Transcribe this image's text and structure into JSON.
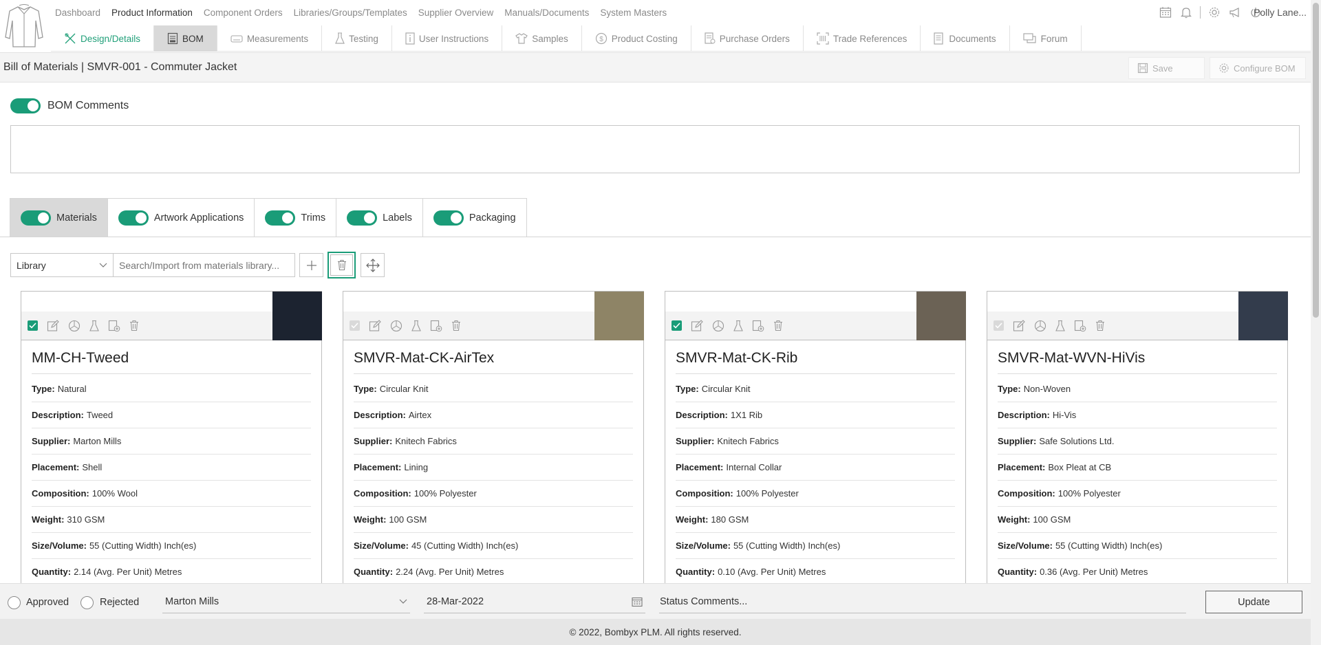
{
  "top_nav": {
    "items": [
      {
        "label": "Dashboard",
        "active": false
      },
      {
        "label": "Product Information",
        "active": true
      },
      {
        "label": "Component Orders",
        "active": false
      },
      {
        "label": "Libraries/Groups/Templates",
        "active": false
      },
      {
        "label": "Supplier Overview",
        "active": false
      },
      {
        "label": "Manuals/Documents",
        "active": false
      },
      {
        "label": "System Masters",
        "active": false
      }
    ],
    "icons": [
      "calendar-icon",
      "bell-icon",
      "gear-icon",
      "megaphone-icon",
      "power-icon"
    ],
    "user": "Polly Lane..."
  },
  "sub_tabs": [
    {
      "label": "Design/Details",
      "icon": "design-icon"
    },
    {
      "label": "BOM",
      "icon": "bom-icon",
      "active": true
    },
    {
      "label": "Measurements",
      "icon": "tape-icon"
    },
    {
      "label": "Testing",
      "icon": "flask-icon"
    },
    {
      "label": "User Instructions",
      "icon": "info-icon"
    },
    {
      "label": "Samples",
      "icon": "shirt-icon"
    },
    {
      "label": "Product Costing",
      "icon": "dollar-icon"
    },
    {
      "label": "Purchase Orders",
      "icon": "purchase-order-icon"
    },
    {
      "label": "Trade References",
      "icon": "barcode-icon"
    },
    {
      "label": "Documents",
      "icon": "documents-icon"
    },
    {
      "label": "Forum",
      "icon": "forum-icon"
    }
  ],
  "title_bar": {
    "title": "Bill of Materials | SMVR-001 - Commuter Jacket",
    "save_label": "Save",
    "configure_label": "Configure BOM"
  },
  "bom_comments": {
    "label": "BOM Comments",
    "enabled": true,
    "value": ""
  },
  "category_tabs": [
    {
      "label": "Materials",
      "enabled": true,
      "active": true
    },
    {
      "label": "Artwork Applications",
      "enabled": true
    },
    {
      "label": "Trims",
      "enabled": true
    },
    {
      "label": "Labels",
      "enabled": true
    },
    {
      "label": "Packaging",
      "enabled": true
    }
  ],
  "library": {
    "select_value": "Library",
    "search_placeholder": "Search/Import from materials library..."
  },
  "field_labels": {
    "type": "Type:",
    "description": "Description:",
    "supplier": "Supplier:",
    "placement": "Placement:",
    "composition": "Composition:",
    "weight": "Weight:",
    "size": "Size/Volume:",
    "quantity": "Quantity:"
  },
  "cards": [
    {
      "title": "MM-CH-Tweed",
      "checked": true,
      "swatch_color": "#1c2330",
      "type": "Natural",
      "description": "Tweed",
      "supplier": "Marton Mills",
      "placement": "Shell",
      "composition": "100% Wool",
      "weight": "310 GSM",
      "size": "55 (Cutting Width) Inch(es)",
      "quantity": "2.14 (Avg. Per Unit) Metres"
    },
    {
      "title": "SMVR-Mat-CK-AirTex",
      "checked": false,
      "swatch_color": "#8e8466",
      "type": "Circular Knit",
      "description": "Airtex",
      "supplier": "Knitech Fabrics",
      "placement": "Lining",
      "composition": "100% Polyester",
      "weight": "100 GSM",
      "size": "45 (Cutting Width) Inch(es)",
      "quantity": "2.24 (Avg. Per Unit) Metres"
    },
    {
      "title": "SMVR-Mat-CK-Rib",
      "checked": true,
      "swatch_color": "#6b6255",
      "type": "Circular Knit",
      "description": "1X1 Rib",
      "supplier": "Knitech Fabrics",
      "placement": "Internal Collar",
      "composition": "100% Polyester",
      "weight": "180 GSM",
      "size": "55 (Cutting Width) Inch(es)",
      "quantity": "0.10 (Avg. Per Unit) Metres"
    },
    {
      "title": "SMVR-Mat-WVN-HiVis",
      "checked": false,
      "swatch_color": "#333c4c",
      "type": "Non-Woven",
      "description": "Hi-Vis",
      "supplier": "Safe Solutions Ltd.",
      "placement": "Box Pleat at CB",
      "composition": "100% Polyester",
      "weight": "100 GSM",
      "size": "55 (Cutting Width) Inch(es)",
      "quantity": "0.36 (Avg. Per Unit) Metres"
    }
  ],
  "status_bar": {
    "approved_label": "Approved",
    "rejected_label": "Rejected",
    "supplier_value": "Marton Mills",
    "date_value": "28-Mar-2022",
    "comments_placeholder": "Status Comments...",
    "update_label": "Update"
  },
  "footer": "© 2022, Bombyx PLM. All rights reserved.",
  "colors": {
    "accent": "#1a9c78",
    "active_tab": "#d9d9d9"
  }
}
